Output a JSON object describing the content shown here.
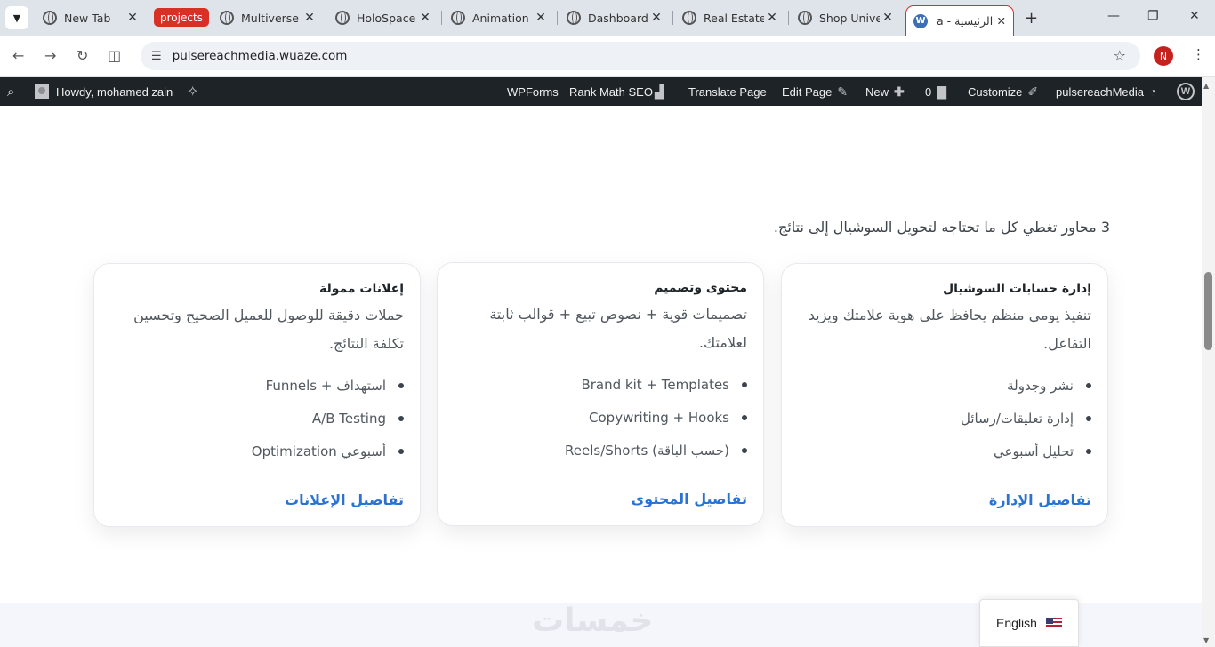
{
  "browser": {
    "tabs": [
      {
        "label": "New Tab"
      },
      {
        "label": "Multiverse"
      },
      {
        "label": "HoloSpace"
      },
      {
        "label": "Animation"
      },
      {
        "label": "Dashboard"
      },
      {
        "label": "Real Estate"
      },
      {
        "label": "Shop Unive"
      }
    ],
    "tab_group_label": "projects",
    "active_tab": {
      "label": "الرئيسية - a"
    },
    "url": "pulsereachmedia.wuaze.com",
    "profile_initial": "N"
  },
  "adminbar": {
    "howdy": "Howdy, mohamed zain",
    "wpforms": "WPForms",
    "rankmath": "Rank Math SEO",
    "translate": "Translate Page",
    "edit_page": "Edit Page",
    "new": "New",
    "comments_count": "0",
    "customize": "Customize",
    "site_name": "pulsereachMedia"
  },
  "page": {
    "intro": "3 محاور تغطي كل ما تحتاجه لتحويل السوشيال إلى نتائج.",
    "cards": [
      {
        "title": "إدارة حسابات السوشيال",
        "desc": "تنفيذ يومي منظم يحافظ على هوية علامتك ويزيد التفاعل.",
        "items": [
          "نشر وجدولة",
          "إدارة تعليقات/رسائل",
          "تحليل أسبوعي"
        ],
        "link": "تفاصيل الإدارة"
      },
      {
        "title": "محتوى وتصميم",
        "desc": "تصميمات قوية + نصوص تبيع + قوالب ثابتة لعلامتك.",
        "items": [
          "Brand kit + Templates",
          "Copywriting + Hooks",
          "Reels/Shorts (حسب الباقة)"
        ],
        "link": "تفاصيل المحتوى"
      },
      {
        "title": "إعلانات ممولة",
        "desc": "حملات دقيقة للوصول للعميل الصحيح وتحسين تكلفة النتائج.",
        "items": [
          "استهداف + Funnels",
          "A/B Testing",
          "Optimization أسبوعي"
        ],
        "link": "تفاصيل الإعلانات"
      }
    ],
    "watermark": "خمسات",
    "language": "English"
  },
  "colors": {
    "link": "#2a73d4",
    "adminbar": "#1d2327",
    "tab_group": "#d93025"
  }
}
